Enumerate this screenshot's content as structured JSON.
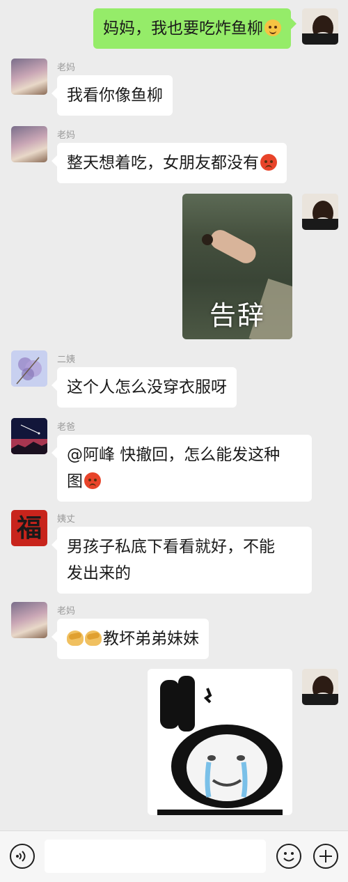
{
  "messages": {
    "m1": {
      "text": "妈妈，我也要吃炸鱼柳"
    },
    "m2": {
      "sender": "老妈",
      "text": "我看你像鱼柳"
    },
    "m3": {
      "sender": "老妈",
      "text": "整天想着吃，女朋友都没有"
    },
    "m4": {
      "image_caption": "告辞"
    },
    "m5": {
      "sender": "二姨",
      "text": "这个人怎么没穿衣服呀"
    },
    "m6": {
      "sender": "老爸",
      "line1": "@阿峰 快撤回，怎么能发这种",
      "line2": "图"
    },
    "m7": {
      "sender": "姨丈",
      "line1": "男孩子私底下看看就好，不能",
      "line2": "发出来的"
    },
    "m8": {
      "sender": "老妈",
      "text": "教坏弟弟妹妹"
    }
  },
  "uncle_avatar_char": "福",
  "input": {
    "placeholder": ""
  },
  "icons": {
    "voice": "voice-icon",
    "emoji": "emoji-icon",
    "plus": "plus-icon"
  },
  "colors": {
    "outgoing_bubble": "#95ec69",
    "incoming_bubble": "#ffffff",
    "background": "#ececec"
  }
}
